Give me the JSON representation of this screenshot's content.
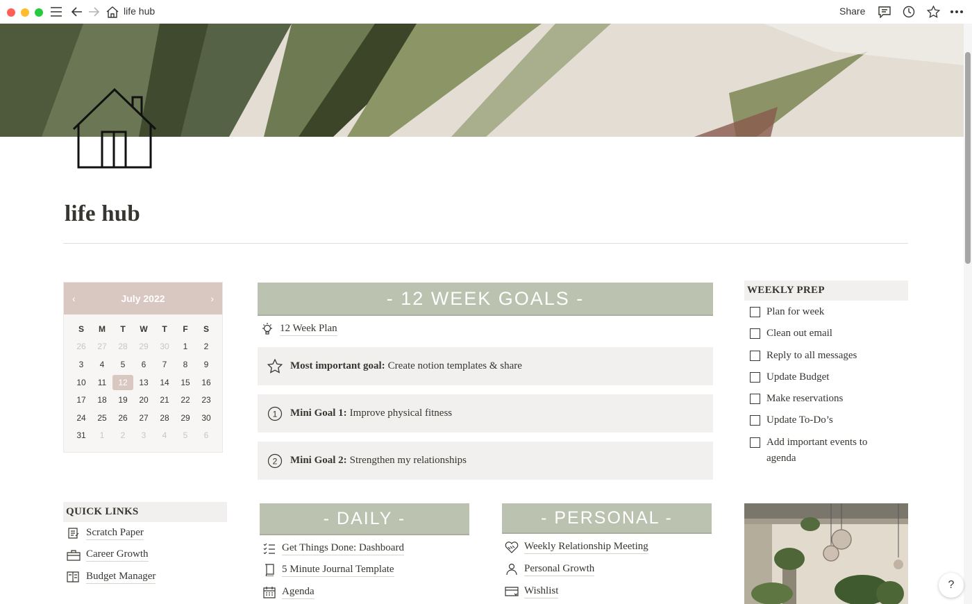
{
  "window": {
    "title": "life hub"
  },
  "toolbar": {
    "share_label": "Share"
  },
  "page": {
    "title": "life hub"
  },
  "calendar": {
    "month_label": "July 2022",
    "weekdays": [
      "S",
      "M",
      "T",
      "W",
      "T",
      "F",
      "S"
    ],
    "weeks": [
      [
        "26",
        "27",
        "28",
        "29",
        "30",
        "1",
        "2"
      ],
      [
        "3",
        "4",
        "5",
        "6",
        "7",
        "8",
        "9"
      ],
      [
        "10",
        "11",
        "12",
        "13",
        "14",
        "15",
        "16"
      ],
      [
        "17",
        "18",
        "19",
        "20",
        "21",
        "22",
        "23"
      ],
      [
        "24",
        "25",
        "26",
        "27",
        "28",
        "29",
        "30"
      ],
      [
        "31",
        "1",
        "2",
        "3",
        "4",
        "5",
        "6"
      ]
    ],
    "today": "12"
  },
  "goals": {
    "banner": "- 12 WEEK GOALS -",
    "plan_link": "12 Week Plan",
    "main_goal": {
      "label": "Most important goal:",
      "text": "Create notion templates & share"
    },
    "mini1": {
      "label": "Mini Goal 1:",
      "text": "Improve physical fitness"
    },
    "mini2": {
      "label": "Mini Goal 2:",
      "text": "Strengthen my relationships"
    }
  },
  "weekly_prep": {
    "heading": "WEEKLY PREP",
    "items": [
      "Plan for week",
      "Clean out email",
      "Reply to all messages",
      "Update Budget",
      "Make reservations",
      "Update To-Do’s",
      "Add important events to agenda"
    ]
  },
  "quick_links": {
    "heading": "QUICK LINKS",
    "items": [
      "Scratch Paper",
      "Career Growth",
      "Budget Manager"
    ]
  },
  "daily": {
    "banner": "- DAILY -",
    "items": [
      "Get Things Done: Dashboard",
      "5 Minute Journal Template",
      "Agenda"
    ]
  },
  "personal": {
    "banner": "- PERSONAL -",
    "items": [
      "Weekly Relationship Meeting",
      "Personal Growth",
      "Wishlist"
    ]
  },
  "help": {
    "label": "?"
  },
  "colors": {
    "banner": "#bcc2b0",
    "calendar_header": "#d9c8c1",
    "callout_bg": "#f1f0ee"
  }
}
